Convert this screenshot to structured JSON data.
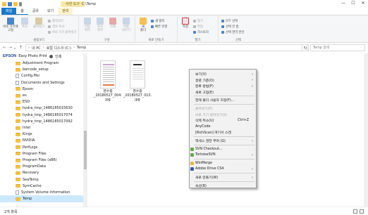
{
  "window": {
    "title": "C:\\Temp",
    "context_tab_title": "사진 도구",
    "minimize": "—",
    "maximize": "☐",
    "close": "✕"
  },
  "ribbon_tabs": [
    "파일",
    "홈",
    "공유",
    "보기",
    "관리"
  ],
  "ribbon": {
    "pin_label": "바로 가기에\n고정",
    "copy_label": "복사",
    "paste_label": "붙여넣기",
    "cut_label": "잘라내기",
    "copy_path_label": "경로 복사",
    "paste_shortcut_label": "바로 가기 붙여넣기",
    "clipboard_group": "클립보드",
    "move_to_label": "이동\n위치",
    "copy_to_label": "복사\n위치",
    "delete_label": "삭제",
    "rename_label": "이름\n바꾸기",
    "organize_group": "구성",
    "new_folder_label": "새\n폴더",
    "new_item_label": "새 항목",
    "easy_access_label": "빠른 연결",
    "new_group": "새로 만들기",
    "properties_label": "속성",
    "open_label": "열기",
    "edit_label": "편집",
    "history_label": "히스토리",
    "open_group": "열기",
    "select_all_label": "모두 선택",
    "select_none_label": "선택 안 함",
    "invert_label": "선택 영역 반전",
    "select_group": "선택"
  },
  "address": {
    "path": [
      "내 PC",
      "로컬 디스크 (C:)",
      "Temp"
    ],
    "search_placeholder": "Temp 검색"
  },
  "sidebar": {
    "epson_brand": "EPSON",
    "epson_app": "Easy Photo Print",
    "epson_action": "인쇄",
    "items": [
      {
        "label": "Adjustment Program",
        "type": "folder"
      },
      {
        "label": "barcode_setup",
        "type": "folder"
      },
      {
        "label": "Config.Msi",
        "type": "file"
      },
      {
        "label": "Documents and Settings",
        "type": "file"
      },
      {
        "label": "Epson",
        "type": "folder"
      },
      {
        "label": "es",
        "type": "folder"
      },
      {
        "label": "ESD",
        "type": "folder"
      },
      {
        "label": "hydra_tmp_1486185015630",
        "type": "folder"
      },
      {
        "label": "hydra_tmp_1486185017074",
        "type": "folder"
      },
      {
        "label": "hydra_tmp_1486185017092",
        "type": "folder"
      },
      {
        "label": "Intel",
        "type": "folder"
      },
      {
        "label": "Kings",
        "type": "folder"
      },
      {
        "label": "NVIDIA",
        "type": "folder"
      },
      {
        "label": "PerfLogs",
        "type": "folder"
      },
      {
        "label": "Program Files",
        "type": "folder"
      },
      {
        "label": "Program Files (x86)",
        "type": "folder"
      },
      {
        "label": "ProgramData",
        "type": "folder"
      },
      {
        "label": "Recovery",
        "type": "folder"
      },
      {
        "label": "SeaTemp",
        "type": "folder"
      },
      {
        "label": "SymCache",
        "type": "folder"
      },
      {
        "label": "System Volume Information",
        "type": "file"
      },
      {
        "label": "Temp",
        "type": "folder",
        "selected": true
      }
    ]
  },
  "files": [
    {
      "name": "영수증\n_20180527_004.\njpg"
    },
    {
      "name": "영수증\n_20180527_010.\njpg"
    }
  ],
  "status": {
    "item_count": "2개 항목"
  },
  "context_menu": {
    "items": [
      {
        "label": "보기(V)",
        "arrow": true
      },
      {
        "label": "정렬 기준(O)",
        "arrow": true
      },
      {
        "label": "분류 방법(P)",
        "arrow": true
      },
      {
        "label": "새로 고침(E)"
      },
      {
        "sep": true
      },
      {
        "label": "현재 폴더 사용자 지정(F)..."
      },
      {
        "sep": true
      },
      {
        "label": "붙여넣기(P)",
        "disabled": true
      },
      {
        "label": "바로 가기 붙여넣기(S)",
        "disabled": true
      },
      {
        "label": "삭제 취소(U)",
        "shortcut": "Ctrl+Z"
      },
      {
        "label": "AnyCode"
      },
      {
        "label": "[RichScan] 여기서 스캔"
      },
      {
        "sep": true
      },
      {
        "label": "액세스 권한 부여 (G)",
        "arrow": true
      },
      {
        "sep": true
      },
      {
        "label": "SVN Checkout...",
        "icon": "#6aa84f"
      },
      {
        "label": "TortoiseSVN",
        "icon": "#6aa84f",
        "arrow": true
      },
      {
        "sep": true
      },
      {
        "label": "WinMerge",
        "icon": "#e8b84a"
      },
      {
        "label": "Adobe Drive CS4",
        "icon": "#3b5aa8",
        "arrow": true
      },
      {
        "sep": true
      },
      {
        "label": "새로 만들기(W)",
        "arrow": true
      },
      {
        "sep": true
      },
      {
        "label": "속성(R)"
      }
    ]
  }
}
